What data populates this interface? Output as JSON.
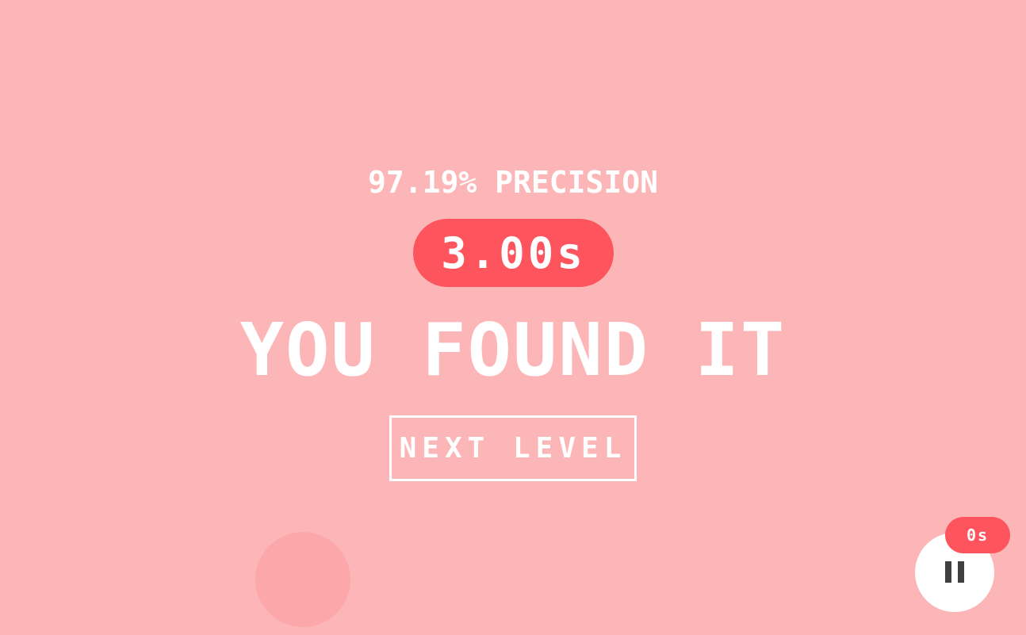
{
  "result": {
    "precision_text": "97.19% PRECISION",
    "time_text": "3.00s",
    "headline": "YOU FOUND IT",
    "next_button_label": "NEXT LEVEL"
  },
  "hud": {
    "timer_text": "0s",
    "pause_icon": "pause-icon"
  },
  "colors": {
    "background": "#fdb6b7",
    "accent": "#fe545d",
    "target": "#fca7a9",
    "text": "#ffffff",
    "icon": "#404040"
  }
}
